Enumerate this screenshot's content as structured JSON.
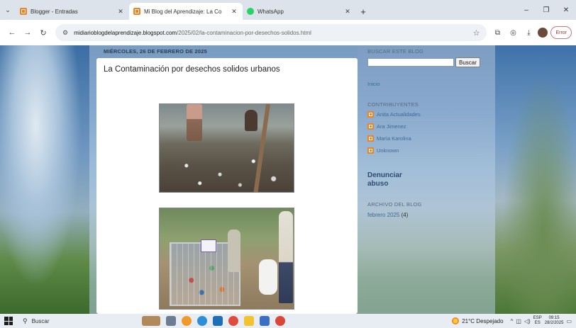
{
  "browser": {
    "tabs": [
      {
        "label": "Blogger - Entradas",
        "icon": "blogger-icon",
        "active": false
      },
      {
        "label": "Mi Blog del Aprendizaje: La Co",
        "icon": "blogger-icon",
        "active": true
      },
      {
        "label": "WhatsApp",
        "icon": "whatsapp-icon",
        "active": false
      }
    ],
    "new_tab": "+",
    "window_controls": {
      "minimize": "–",
      "maximize": "❐",
      "close": "✕"
    },
    "url_host": "midiarioblogdelaprendizaje.blogspot.com",
    "url_path": "/2025/02/la-contaminacion-por-desechos-solidos.html",
    "error_label": "Error"
  },
  "blog": {
    "date_header": "MIÉRCOLES, 26 DE FEBRERO DE 2025",
    "post_title": "La Contaminación por desechos solidos urbanos",
    "sidebar": {
      "search_heading": "BUSCAR ESTE BLOG",
      "search_button": "Buscar",
      "search_value": "",
      "home_link": "Inicio",
      "contributors_heading": "CONTRIBUYENTES",
      "contributors": [
        "Anita Actualidades",
        "Ara Jimenez",
        "María Karolina",
        "Unknown"
      ],
      "report_abuse_line1": "Denunciar",
      "report_abuse_line2": "abuso",
      "archive_heading": "ARCHIVO DEL BLOG",
      "archive_item": "febrero 2025",
      "archive_count": "(4)"
    }
  },
  "taskbar": {
    "search_label": "Buscar",
    "weather": "21°C  Despejado",
    "lang_line1": "ESP",
    "lang_line2": "ES",
    "time": "09:15",
    "date": "28/2/2025"
  },
  "colors": {
    "blogger_orange": "#f4811f",
    "link_blue": "#3e6a94",
    "whatsapp_green": "#25d366"
  }
}
